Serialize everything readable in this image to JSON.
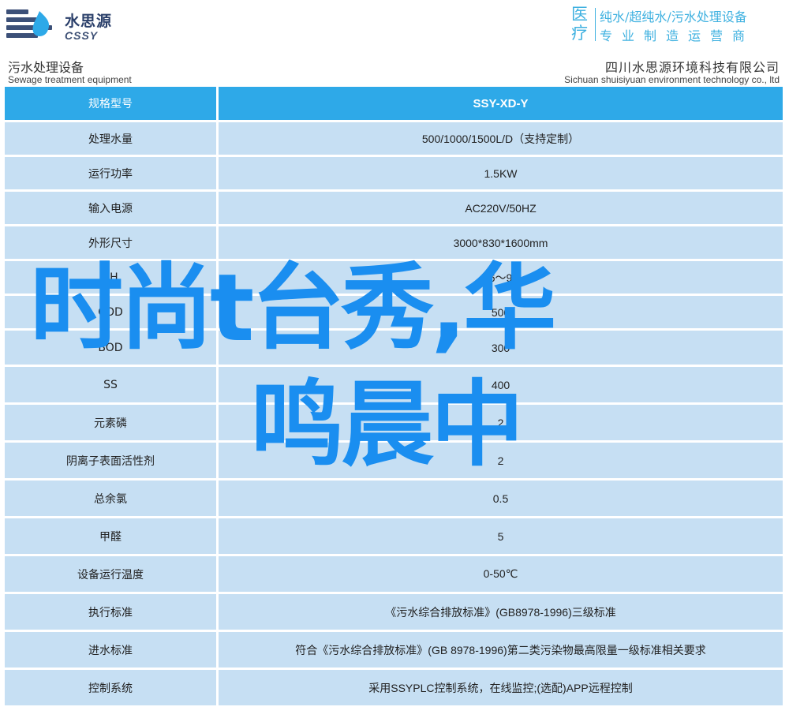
{
  "brand": {
    "name_cn": "水思源",
    "name_en": "CSSY",
    "colors": {
      "accent": "#2ea9e8",
      "row": "#c6dff3",
      "slogan": "#3fb1e0",
      "overlay": "#1a8ef0"
    }
  },
  "slogan": {
    "tag": [
      "医",
      "疗"
    ],
    "line1": "纯水/超纯水/污水处理设备",
    "line2": "专业制造运营商"
  },
  "header": {
    "left_cn": "污水处理设备",
    "left_en": "Sewage treatment equipment",
    "right_cn": "四川水思源环境科技有限公司",
    "right_en": "Sichuan shuisiyuan environment technology co., ltd"
  },
  "table": {
    "header": {
      "label": "规格型号",
      "value": "SSY-XD-Y"
    },
    "rows": [
      {
        "label": "处理水量",
        "value": "500/1000/1500L/D（支持定制）"
      },
      {
        "label": "运行功率",
        "value": "1.5KW"
      },
      {
        "label": "输入电源",
        "value": "AC220V/50HZ"
      },
      {
        "label": "外形尺寸",
        "value": "3000*830*1600mm"
      },
      {
        "label": "pH",
        "value": "6～9"
      },
      {
        "label": "COD",
        "value": "500"
      },
      {
        "label": "BOD",
        "value": "300"
      },
      {
        "label": "SS",
        "value": "400"
      },
      {
        "label": "元素磷",
        "value": "2"
      },
      {
        "label": "阴离子表面活性剂",
        "value": "2"
      },
      {
        "label": "总余氯",
        "value": "0.5"
      },
      {
        "label": "甲醛",
        "value": "5"
      },
      {
        "label": "设备运行温度",
        "value": "0-50℃"
      },
      {
        "label": "执行标准",
        "value": "《污水综合排放标准》(GB8978-1996)三级标准"
      },
      {
        "label": "进水标准",
        "value": "符合《污水综合排放标准》(GB 8978-1996)第二类污染物最高限量一级标准相关要求"
      },
      {
        "label": "控制系统",
        "value": "采用SSYPLC控制系统，在线监控;(选配)APP远程控制"
      }
    ]
  },
  "overlay": {
    "line1": "时尚t台秀,华",
    "line2": "鸣晨中"
  }
}
